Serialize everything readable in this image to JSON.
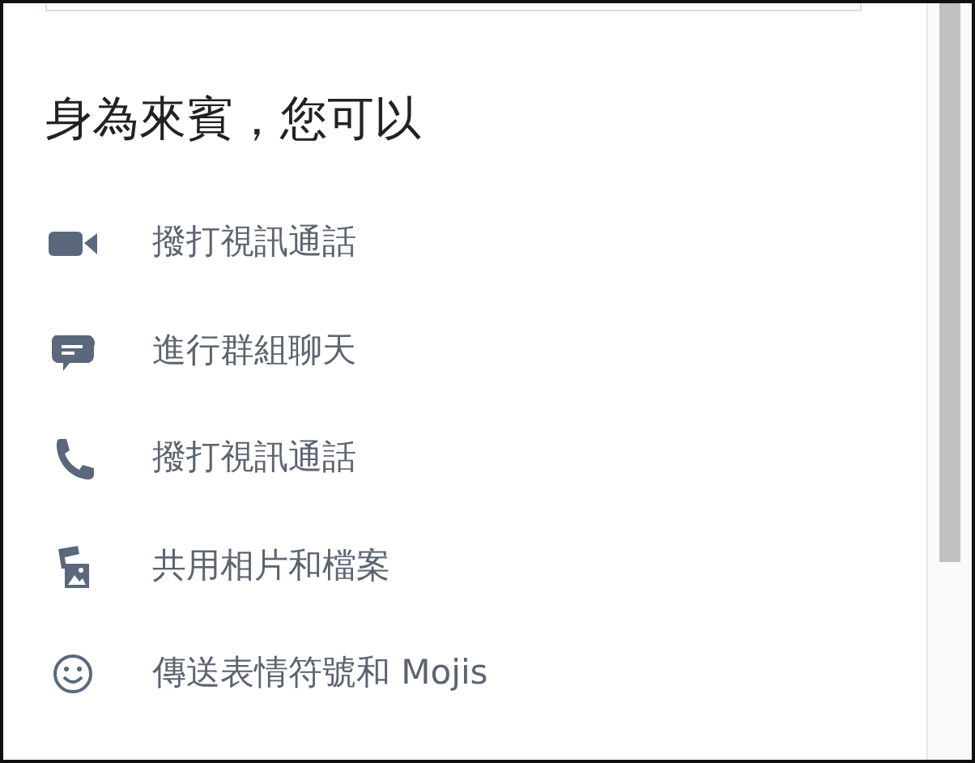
{
  "heading": "身為來賓，您可以",
  "features": [
    {
      "kind": "video",
      "label": "撥打視訊通話"
    },
    {
      "kind": "chat",
      "label": "進行群組聊天"
    },
    {
      "kind": "phone",
      "label": "撥打視訊通話"
    },
    {
      "kind": "photos",
      "label": "共用相片和檔案"
    },
    {
      "kind": "emoji",
      "label": "傳送表情符號和 Mojis"
    }
  ]
}
